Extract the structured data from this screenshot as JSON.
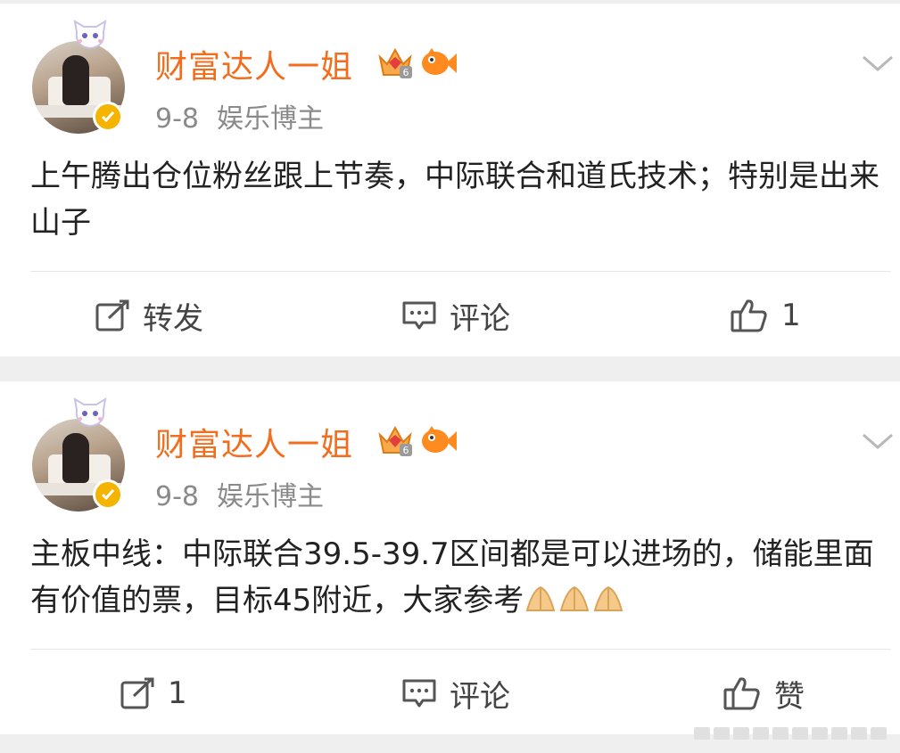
{
  "posts": [
    {
      "user": {
        "name": "财富达人一姐",
        "verified": true,
        "crown_level": "6"
      },
      "meta": {
        "date": "9-8",
        "tag": "娱乐博主"
      },
      "content": "上午腾出仓位粉丝跟上节奏，中际联合和道氏技术；特别是出来山子",
      "actions": {
        "repost": "转发",
        "comment": "评论",
        "like": "1"
      }
    },
    {
      "user": {
        "name": "财富达人一姐",
        "verified": true,
        "crown_level": "6"
      },
      "meta": {
        "date": "9-8",
        "tag": "娱乐博主"
      },
      "content": "主板中线：中际联合39.5-39.7区间都是可以进场的，储能里面有价值的票，目标45附近，大家参考",
      "actions": {
        "repost": "1",
        "comment": "评论",
        "like": "赞"
      }
    }
  ],
  "colors": {
    "username": "#f26d1d",
    "meta": "#8a8a8a",
    "text": "#222222",
    "verified_badge": "#f5b400"
  }
}
